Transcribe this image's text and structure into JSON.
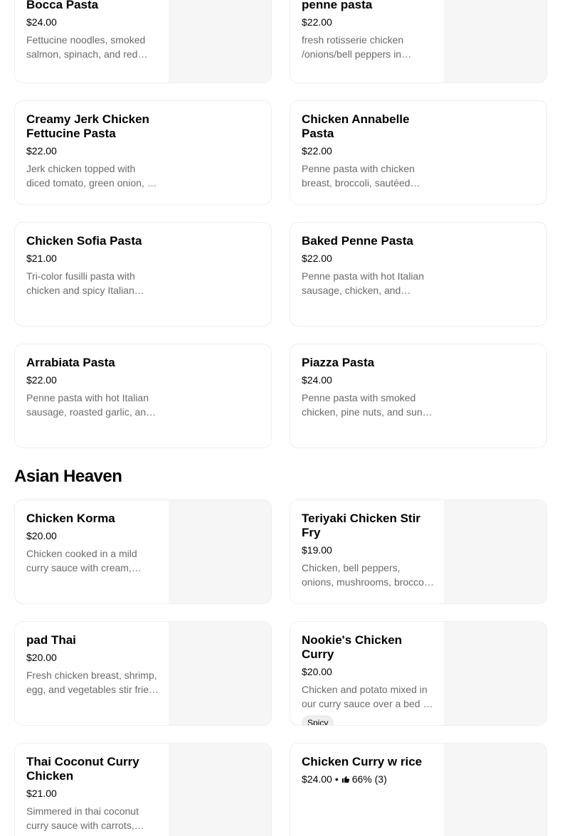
{
  "pasta_items": [
    {
      "name": "Bocca Pasta",
      "price": "$24.00",
      "description": "Fettucine noodles, smoked salmon, spinach, and red peppers in our cream sauce."
    },
    {
      "name": "Chicken Creamy Curry penne pasta",
      "price": "$22.00",
      "description": "fresh rotisserie chicken /onions/bell peppers in creamy curry sauce."
    },
    {
      "name": "Creamy Jerk Chicken Fettucine Pasta",
      "price": "$22.00",
      "description": "Jerk chicken topped with diced tomato, green onion, in creamy jerk sauce."
    },
    {
      "name": "Chicken Annabelle Pasta",
      "price": "$22.00",
      "description": "Penne pasta with chicken breast, broccoli, sautéed mushrooms in cream sauce."
    },
    {
      "name": "Chicken Sofia Pasta",
      "price": "$21.00",
      "description": "Tri-color fusilli pasta with chicken and spicy Italian sausage in tomato cream sauce."
    },
    {
      "name": "Baked Penne Pasta",
      "price": "$22.00",
      "description": "Penne pasta with hot Italian sausage, chicken, and mozzarella baked in marinara."
    },
    {
      "name": "Arrabiata Pasta",
      "price": "$22.00",
      "description": "Penne pasta with hot Italian sausage, roasted garlic, and spicy tomato sauce."
    },
    {
      "name": "Piazza Pasta",
      "price": "$24.00",
      "description": "Penne pasta with smoked chicken, pine nuts, and sun-dried tomatoes in pesto cream."
    }
  ],
  "asian_section": {
    "title": "Asian Heaven"
  },
  "asian_items": [
    {
      "name": "Chicken Korma",
      "price": "$20.00",
      "description": "Chicken cooked in a mild curry sauce with cream, served over basmati rice."
    },
    {
      "name": "Teriyaki Chicken Stir Fry",
      "price": "$19.00",
      "description": "Chicken, bell peppers, onions, mushrooms, broccoli in teriyaki sauce over rice."
    },
    {
      "name": "pad Thai",
      "price": "$20.00",
      "description": "Fresh chicken breast, shrimp, egg, and vegetables stir fried with rice noodles."
    },
    {
      "name": "Nookie's Chicken Curry",
      "price": "$20.00",
      "description": "Chicken and potato mixed in our curry sauce over a bed of rice.",
      "badge": "Spicy"
    },
    {
      "name": "Thai Coconut Curry Chicken",
      "price": "$21.00",
      "description": "Simmered in thai coconut curry sauce with carrots, peppers and basil."
    },
    {
      "name": "Chicken Curry w rice",
      "price": "$24.00",
      "separator": "•",
      "rating": "66% (3)"
    }
  ]
}
